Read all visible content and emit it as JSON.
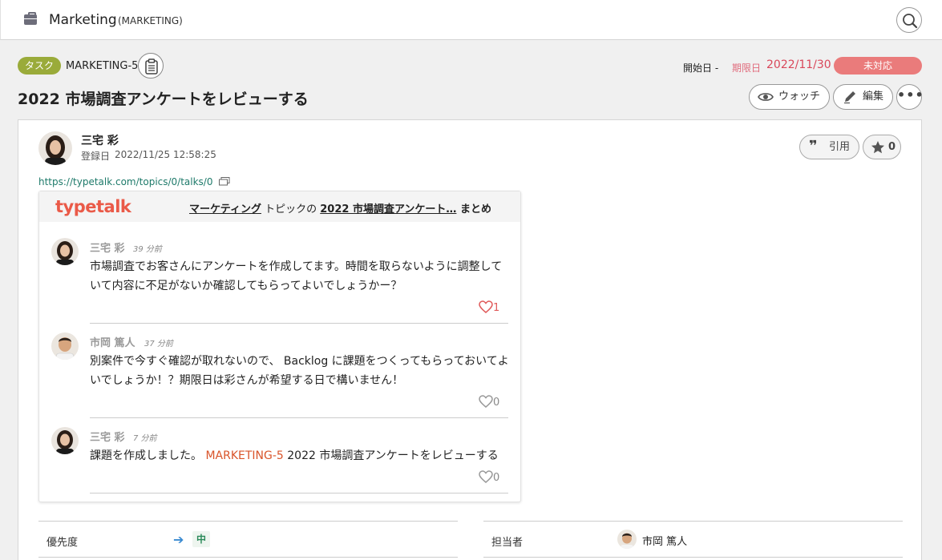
{
  "header": {
    "project_name": "Marketing",
    "project_key": "(MARKETING)",
    "icons": {
      "project": "briefcase-icon",
      "search": "search-icon"
    }
  },
  "issue": {
    "type_tag": "タスク",
    "key": "MARKETING-5",
    "start_label": "開始日",
    "start_value": "-",
    "due_label": "期限日",
    "due_value": "2022/11/30",
    "status": "未対応",
    "title": "2022 市場調査アンケートをレビューする",
    "watch_label": "ウォッチ",
    "edit_label": "編集",
    "more_label": "•••"
  },
  "description": {
    "author": "三宅 彩",
    "registered_label": "登録日",
    "registered_date": "2022/11/25 12:58:25",
    "quote_label": "引用",
    "star_count": "0",
    "link": "https://typetalk.com/topics/0/talks/0"
  },
  "embed": {
    "logo": "typetalk",
    "title_topic": "マーケティング",
    "title_mid": " トピックの ",
    "title_talk": "2022 市場調査アンケート…",
    "title_tail": " まとめ",
    "messages": [
      {
        "name": "三宅 彩",
        "time": "39 分前",
        "text": "市場調査でお客さんにアンケートを作成してます。時間を取らないように調整していて内容に不足がないか確認してもらってよいでしょうかー？",
        "likes": "1",
        "liked": true
      },
      {
        "name": "市岡 篤人",
        "time": "37 分前",
        "text": "別案件で今すぐ確認が取れないので、 Backlog に課題をつくってもらっておいてよいでしょうか！？期限日は彩さんが希望する日で構いません！",
        "likes": "0",
        "liked": false
      },
      {
        "name": "三宅 彩",
        "time": "7 分前",
        "text_prefix": "課題を作成しました。 ",
        "issue_ref": "MARKETING-5",
        "text_suffix": " 2022 市場調査アンケートをレビューする",
        "likes": "0",
        "liked": false
      }
    ]
  },
  "properties": {
    "priority_label": "優先度",
    "priority_value": "中",
    "assignee_label": "担当者",
    "assignee_name": "市岡 篤人"
  },
  "colors": {
    "tag": "#9aab3a",
    "status": "#ea7b7b",
    "due": "#d9475a",
    "typetalk": "#ea5a48",
    "like_active": "#e05a5a"
  }
}
